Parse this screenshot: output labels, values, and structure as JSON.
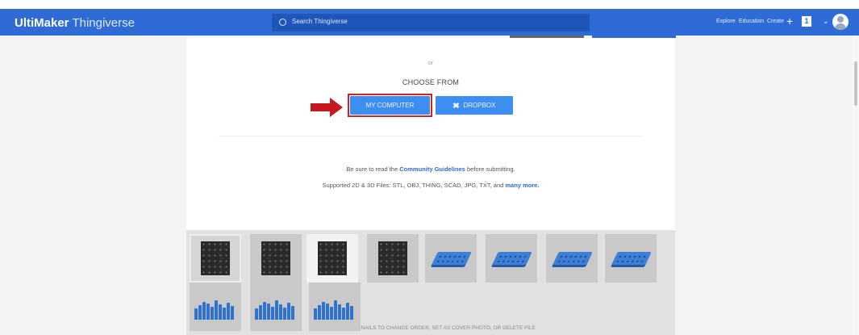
{
  "header": {
    "brand_bold": "UltiMaker",
    "brand_light": "Thingiverse",
    "search_placeholder": "Search Thingiverse",
    "nav": [
      "Explore",
      "Education",
      "Create"
    ],
    "plus": "+",
    "badge": "1"
  },
  "upload": {
    "or_text": "or",
    "choose_from": "CHOOSE FROM",
    "my_computer_label": "MY COMPUTER",
    "dropbox_label": "DROPBOX",
    "guidelines_prefix": "Be sure to read the",
    "guidelines_link": "Community Guidelines",
    "guidelines_suffix": "before submitting.",
    "supported_prefix": "Supported 2D & 3D Files: STL, OBJ, THING, SCAD, JPG, TXT, and",
    "supported_link": "many more."
  },
  "thumbnails": {
    "items": [
      {
        "kind": "plate",
        "selected": true
      },
      {
        "kind": "plate",
        "selected": false
      },
      {
        "kind": "plate-light",
        "selected": false
      },
      {
        "kind": "plate",
        "selected": false
      },
      {
        "kind": "tray",
        "selected": false
      },
      {
        "kind": "tray",
        "selected": false
      },
      {
        "kind": "tray",
        "selected": false
      },
      {
        "kind": "tray",
        "selected": false
      },
      {
        "kind": "pegs",
        "selected": false
      },
      {
        "kind": "pegs",
        "selected": false
      },
      {
        "kind": "pegs",
        "selected": false
      }
    ],
    "instruction": "DRAG THUMBNAILS TO CHANGE ORDER, SET AS COVER PHOTO, OR DELETE FILE"
  },
  "annotation": {
    "arrow_color": "#c8181f",
    "highlight_color": "#d0202a"
  },
  "colors": {
    "nav_blue": "#2e6bd6",
    "button_blue": "#3d8ef0",
    "link_blue": "#2e6bd6"
  },
  "icons": [
    "search-icon",
    "dropbox-icon",
    "avatar-icon",
    "chevron-down-icon"
  ]
}
